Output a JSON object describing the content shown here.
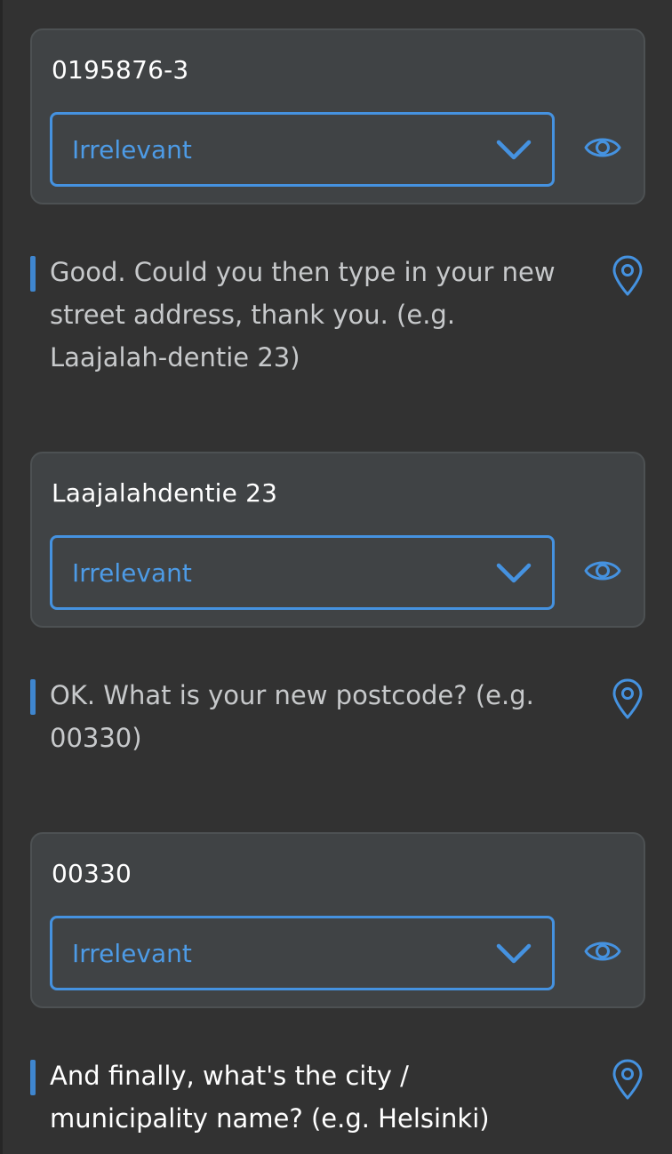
{
  "responses": [
    {
      "value": "0195876-3",
      "select_value": "Irrelevant"
    },
    {
      "value": "Laajalahdentie 23",
      "select_value": "Irrelevant"
    },
    {
      "value": "00330",
      "select_value": "Irrelevant"
    }
  ],
  "messages": [
    {
      "text": "Good. Could you then type in your new street address, thank you. (e.g. Laajalah-dentie 23)"
    },
    {
      "text": "OK. What is your new postcode? (e.g. 00330)"
    },
    {
      "text": "And finally, what's the city / municipality name? (e.g. Helsinki)"
    }
  ],
  "icons": {
    "select_toggle": "chevron-down-icon",
    "visibility": "eye-icon",
    "location": "map-pin-icon"
  },
  "colors": {
    "background": "#323232",
    "card": "#404345",
    "accent": "#4592e0",
    "message_bar": "#3f86cf",
    "message_text": "#c7c9cb"
  }
}
